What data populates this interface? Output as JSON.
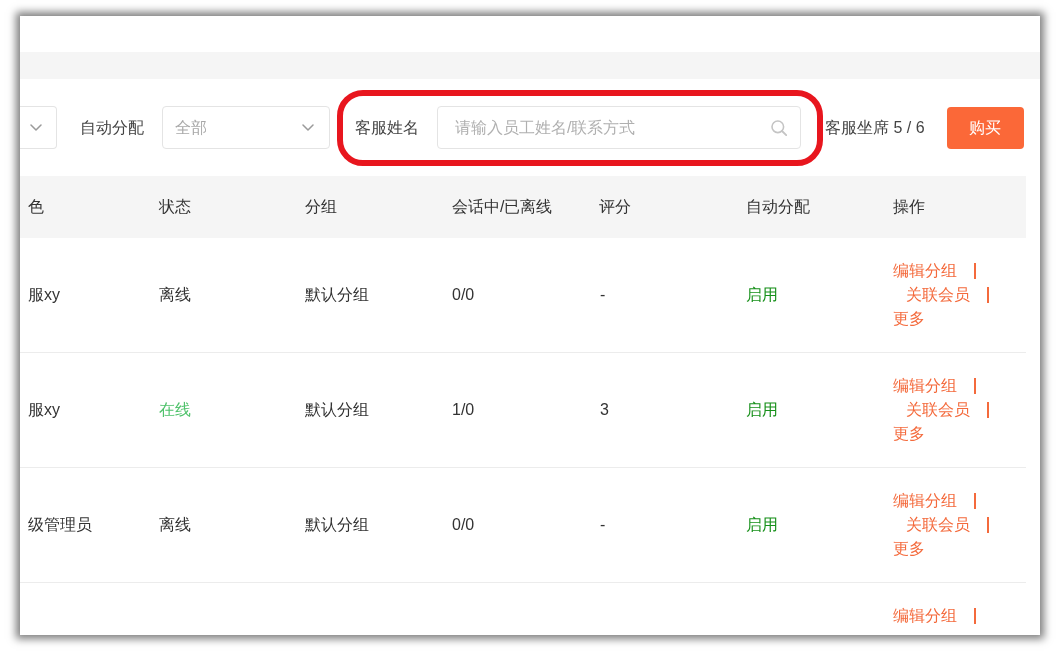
{
  "filters": [
    {
      "kind": "select"
    },
    {
      "kind": "select",
      "label": "自动分配",
      "value": "全部"
    },
    {
      "kind": "search",
      "label": "客服姓名",
      "placeholder": "请输入员工姓名/联系方式",
      "highlighted": true
    }
  ],
  "seats": "客服坐席 5 / 6",
  "buy_button": "购买",
  "table": {
    "columns": [
      "色",
      "状态",
      "分组",
      "会话中/已离线",
      "评分",
      "自动分配",
      "操作"
    ],
    "rows": [
      {
        "column_1": "服xy",
        "status": "离线",
        "online": false,
        "group": "默认分组",
        "sessions": "0/0",
        "rating": "-",
        "auto_assign": "启用",
        "enabled": true,
        "actions": [
          {
            "label": "编辑分组",
            "separator": true
          },
          {
            "label": "关联会员",
            "separator": true
          },
          {
            "label": "更多",
            "separator": false
          }
        ]
      },
      {
        "column_1": "服xy",
        "status": "在线",
        "online": true,
        "group": "默认分组",
        "sessions": "1/0",
        "rating": "3",
        "auto_assign": "启用",
        "enabled": true,
        "actions": [
          {
            "label": "编辑分组",
            "separator": true
          },
          {
            "label": "关联会员",
            "separator": true
          },
          {
            "label": "更多",
            "separator": false
          }
        ]
      },
      {
        "column_1": "级管理员",
        "status": "离线",
        "online": false,
        "group": "默认分组",
        "sessions": "0/0",
        "rating": "-",
        "auto_assign": "启用",
        "enabled": true,
        "actions": [
          {
            "label": "编辑分组",
            "separator": true
          },
          {
            "label": "关联会员",
            "separator": true
          },
          {
            "label": "更多",
            "separator": false
          }
        ]
      },
      {
        "actions": [
          {
            "label": "编辑分组",
            "separator": true
          }
        ]
      }
    ]
  }
}
